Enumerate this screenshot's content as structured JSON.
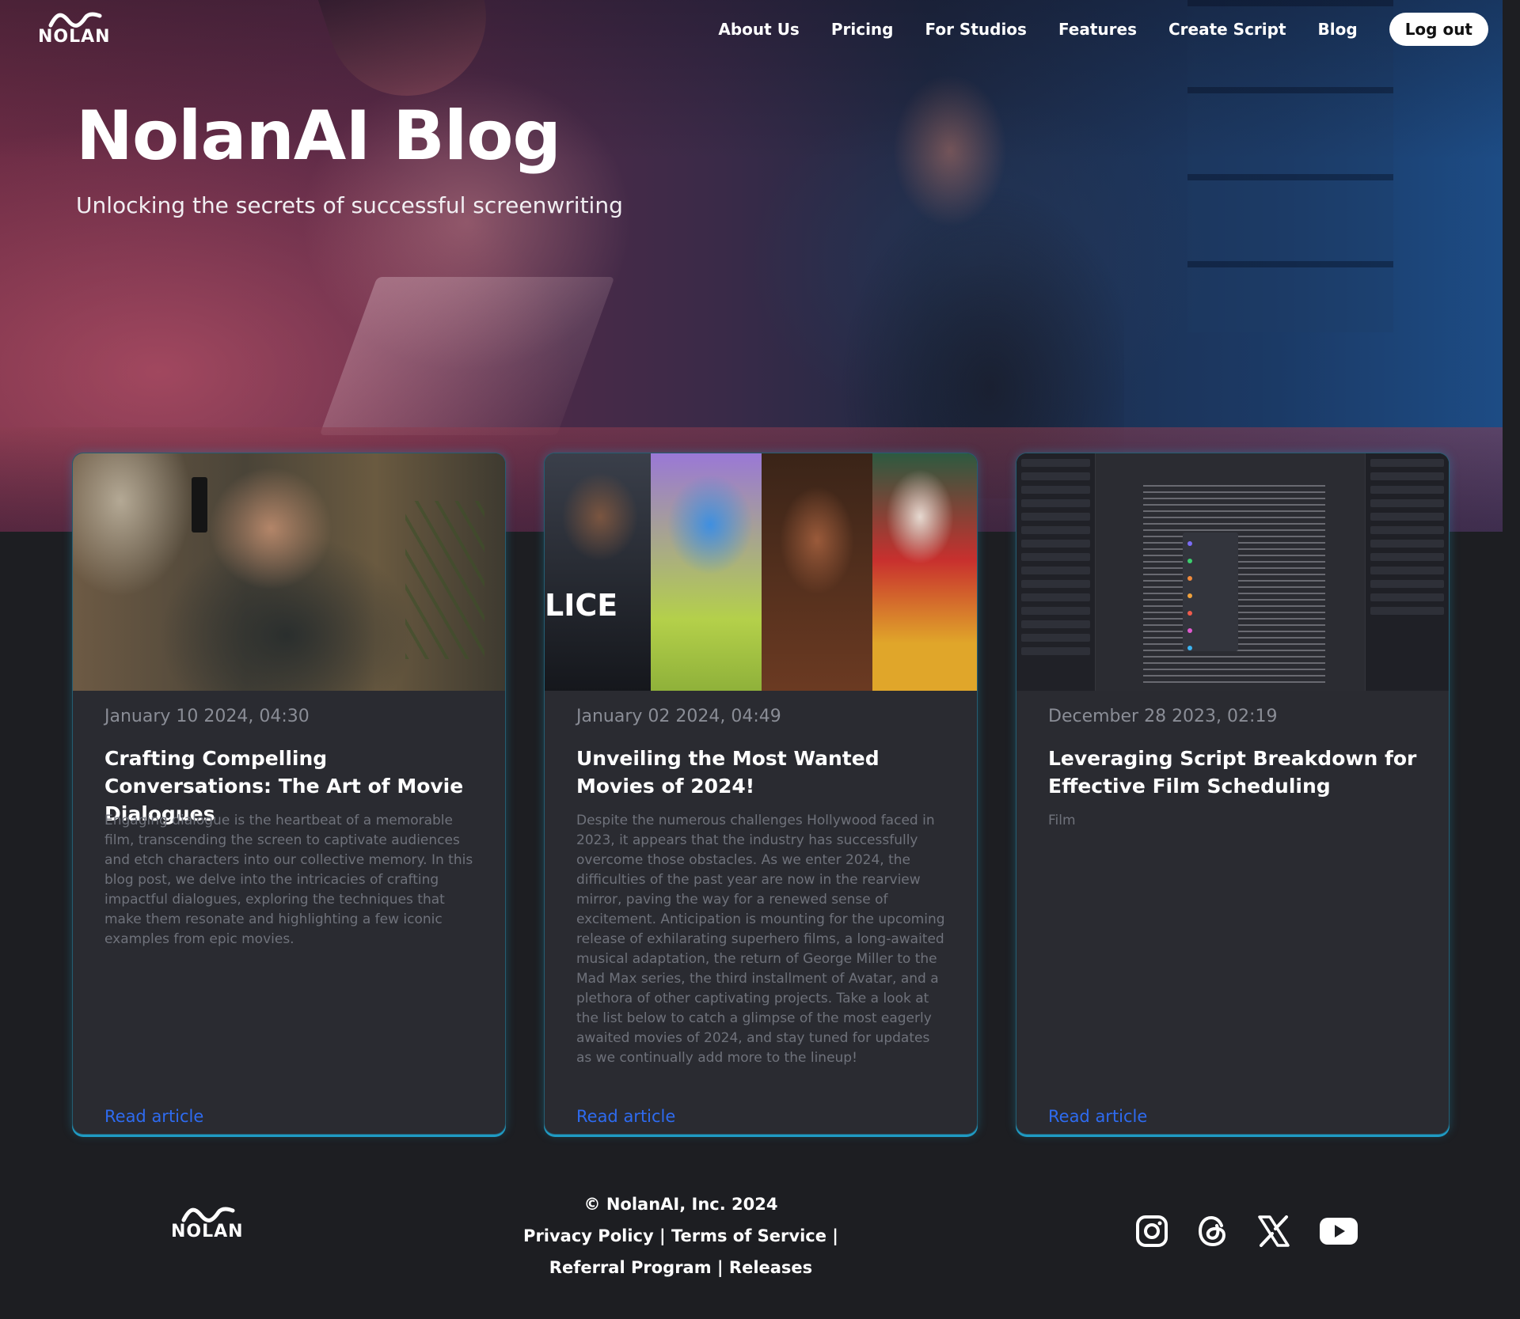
{
  "brand": {
    "logo_text": "NOLAN"
  },
  "nav": {
    "items": [
      "About Us",
      "Pricing",
      "For Studios",
      "Features",
      "Create Script",
      "Blog"
    ],
    "logout_label": "Log out"
  },
  "hero": {
    "title": "NolanAI Blog",
    "subtitle": "Unlocking the secrets of successful screenwriting"
  },
  "posts": [
    {
      "date": "January 10 2024, 04:30",
      "title": "Crafting Compelling Conversations: The Art of Movie Dialogues",
      "excerpt": "Engaging dialogue is the heartbeat of a memorable film, transcending the screen to captivate audiences and etch characters into our collective memory. In this blog post, we delve into the intricacies of crafting impactful dialogues, exploring the techniques that make them resonate and highlighting a few iconic examples from epic movies.",
      "read_label": "Read article"
    },
    {
      "date": "January 02 2024, 04:49",
      "title": "Unveiling the Most Wanted Movies of 2024!",
      "excerpt": "Despite the numerous challenges Hollywood faced in 2023, it appears that the industry has successfully overcome those obstacles. As we enter 2024, the difficulties of the past year are now in the rearview mirror, paving the way for a renewed sense of excitement. Anticipation is mounting for the upcoming release of exhilarating superhero films, a long-awaited musical adaptation, the return of George Miller to the Mad Max series, the third installment of Avatar, and a plethora of other captivating projects. Take a look at the list below to catch a glimpse of the most eagerly awaited movies of 2024, and stay tuned for updates as we continually add more to the lineup!",
      "read_label": "Read article",
      "thumb_text": "LICE"
    },
    {
      "date": "December 28 2023, 02:19",
      "title": "Leveraging Script Breakdown for Effective Film Scheduling",
      "excerpt": "Film",
      "read_label": "Read article"
    }
  ],
  "footer": {
    "copyright": "© NolanAI, Inc. 2024",
    "links": [
      "Privacy Policy",
      "Terms of Service",
      "Referral Program",
      "Releases"
    ],
    "separator": "|",
    "socials": [
      "instagram-icon",
      "threads-icon",
      "x-icon",
      "youtube-icon"
    ]
  },
  "colors": {
    "background": "#1d1e22",
    "card": "#2a2b31",
    "card_glow": "#1f9bc4",
    "link": "#2e6bf0",
    "muted_text": "#6f727b",
    "date_text": "#8a8d96"
  }
}
